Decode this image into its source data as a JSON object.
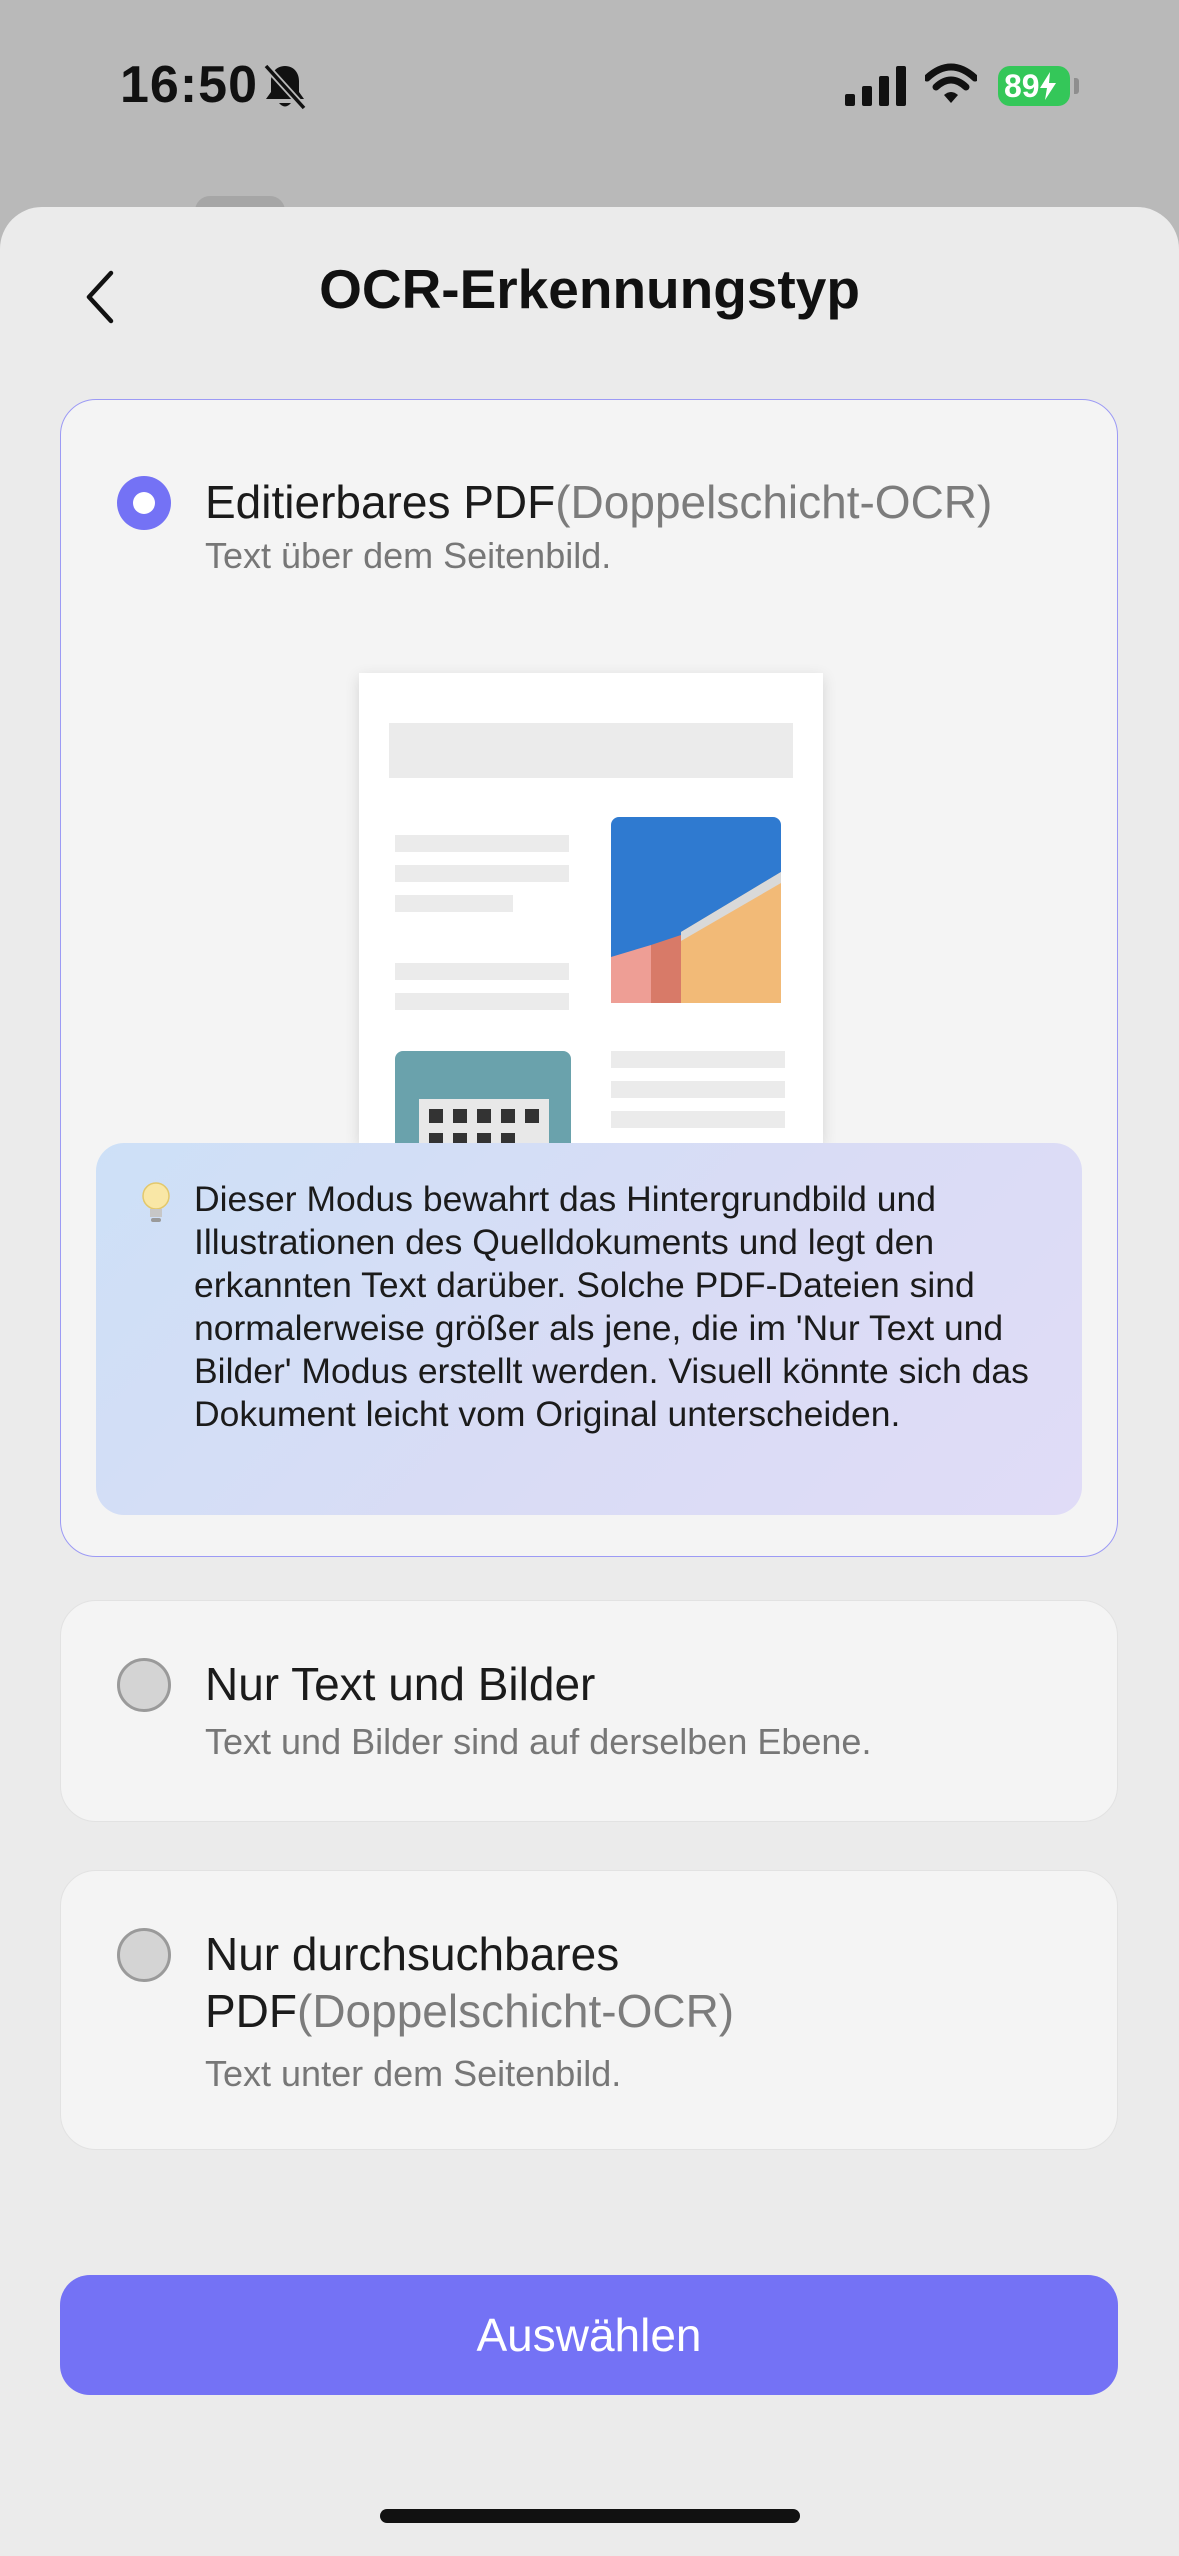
{
  "status_bar": {
    "time": "16:50",
    "battery": "89"
  },
  "nav": {
    "title": "OCR-Erkennungstyp"
  },
  "options": [
    {
      "title": "Editierbares PDF",
      "title_paren": "(Doppelschicht-OCR)",
      "subtitle": "Text über dem Seitenbild.",
      "selected": true
    },
    {
      "title": "Nur Text und Bilder",
      "subtitle": "Text und Bilder sind auf derselben Ebene.",
      "selected": false
    },
    {
      "title_line1": "Nur durchsuchbares",
      "title_line2": "PDF",
      "title_paren": "(Doppelschicht-OCR)",
      "subtitle": "Text unter dem Seitenbild.",
      "selected": false
    }
  ],
  "tip": {
    "text": "Dieser Modus bewahrt das Hintergrundbild und Illustrationen des Quelldokuments und legt den erkannten Text darüber. Solche PDF-Dateien sind normalerweise größer als jene, die im 'Nur Text und Bilder' Modus erstellt werden. Visuell könnte sich das Dokument leicht vom Original unterscheiden."
  },
  "button": {
    "label": "Auswählen"
  },
  "colors": {
    "accent": "#7472f5",
    "battery": "#34c759",
    "sheet": "#ebebeb"
  },
  "icons": [
    "bell-slash-icon",
    "cellular-signal-icon",
    "wifi-icon",
    "battery-icon",
    "chevron-left-icon",
    "lightbulb-icon"
  ]
}
